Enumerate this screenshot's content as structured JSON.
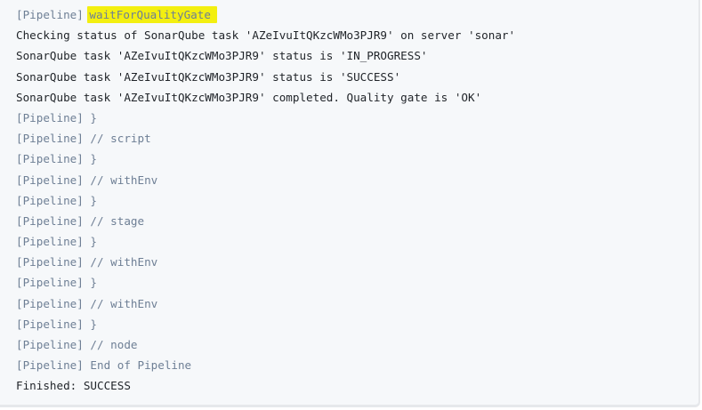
{
  "console": {
    "highlight_color": "#f3ef10",
    "lines": [
      {
        "prefix": "[Pipeline]",
        "text": "",
        "highlight": "waitForQualityGate"
      },
      {
        "prefix": "",
        "text": "Checking status of SonarQube task 'AZeIvuItQKzcWMo3PJR9' on server 'sonar'"
      },
      {
        "prefix": "",
        "text": "SonarQube task 'AZeIvuItQKzcWMo3PJR9' status is 'IN_PROGRESS'"
      },
      {
        "prefix": "",
        "text": "SonarQube task 'AZeIvuItQKzcWMo3PJR9' status is 'SUCCESS'"
      },
      {
        "prefix": "",
        "text": "SonarQube task 'AZeIvuItQKzcWMo3PJR9' completed. Quality gate is 'OK'"
      },
      {
        "prefix": "[Pipeline]",
        "text": " }"
      },
      {
        "prefix": "[Pipeline]",
        "text": " // script"
      },
      {
        "prefix": "[Pipeline]",
        "text": " }"
      },
      {
        "prefix": "[Pipeline]",
        "text": " // withEnv"
      },
      {
        "prefix": "[Pipeline]",
        "text": " }"
      },
      {
        "prefix": "[Pipeline]",
        "text": " // stage"
      },
      {
        "prefix": "[Pipeline]",
        "text": " }"
      },
      {
        "prefix": "[Pipeline]",
        "text": " // withEnv"
      },
      {
        "prefix": "[Pipeline]",
        "text": " }"
      },
      {
        "prefix": "[Pipeline]",
        "text": " // withEnv"
      },
      {
        "prefix": "[Pipeline]",
        "text": " }"
      },
      {
        "prefix": "[Pipeline]",
        "text": " // node"
      },
      {
        "prefix": "[Pipeline]",
        "text": " End of Pipeline"
      },
      {
        "prefix": "",
        "text": "Finished: SUCCESS"
      }
    ]
  }
}
